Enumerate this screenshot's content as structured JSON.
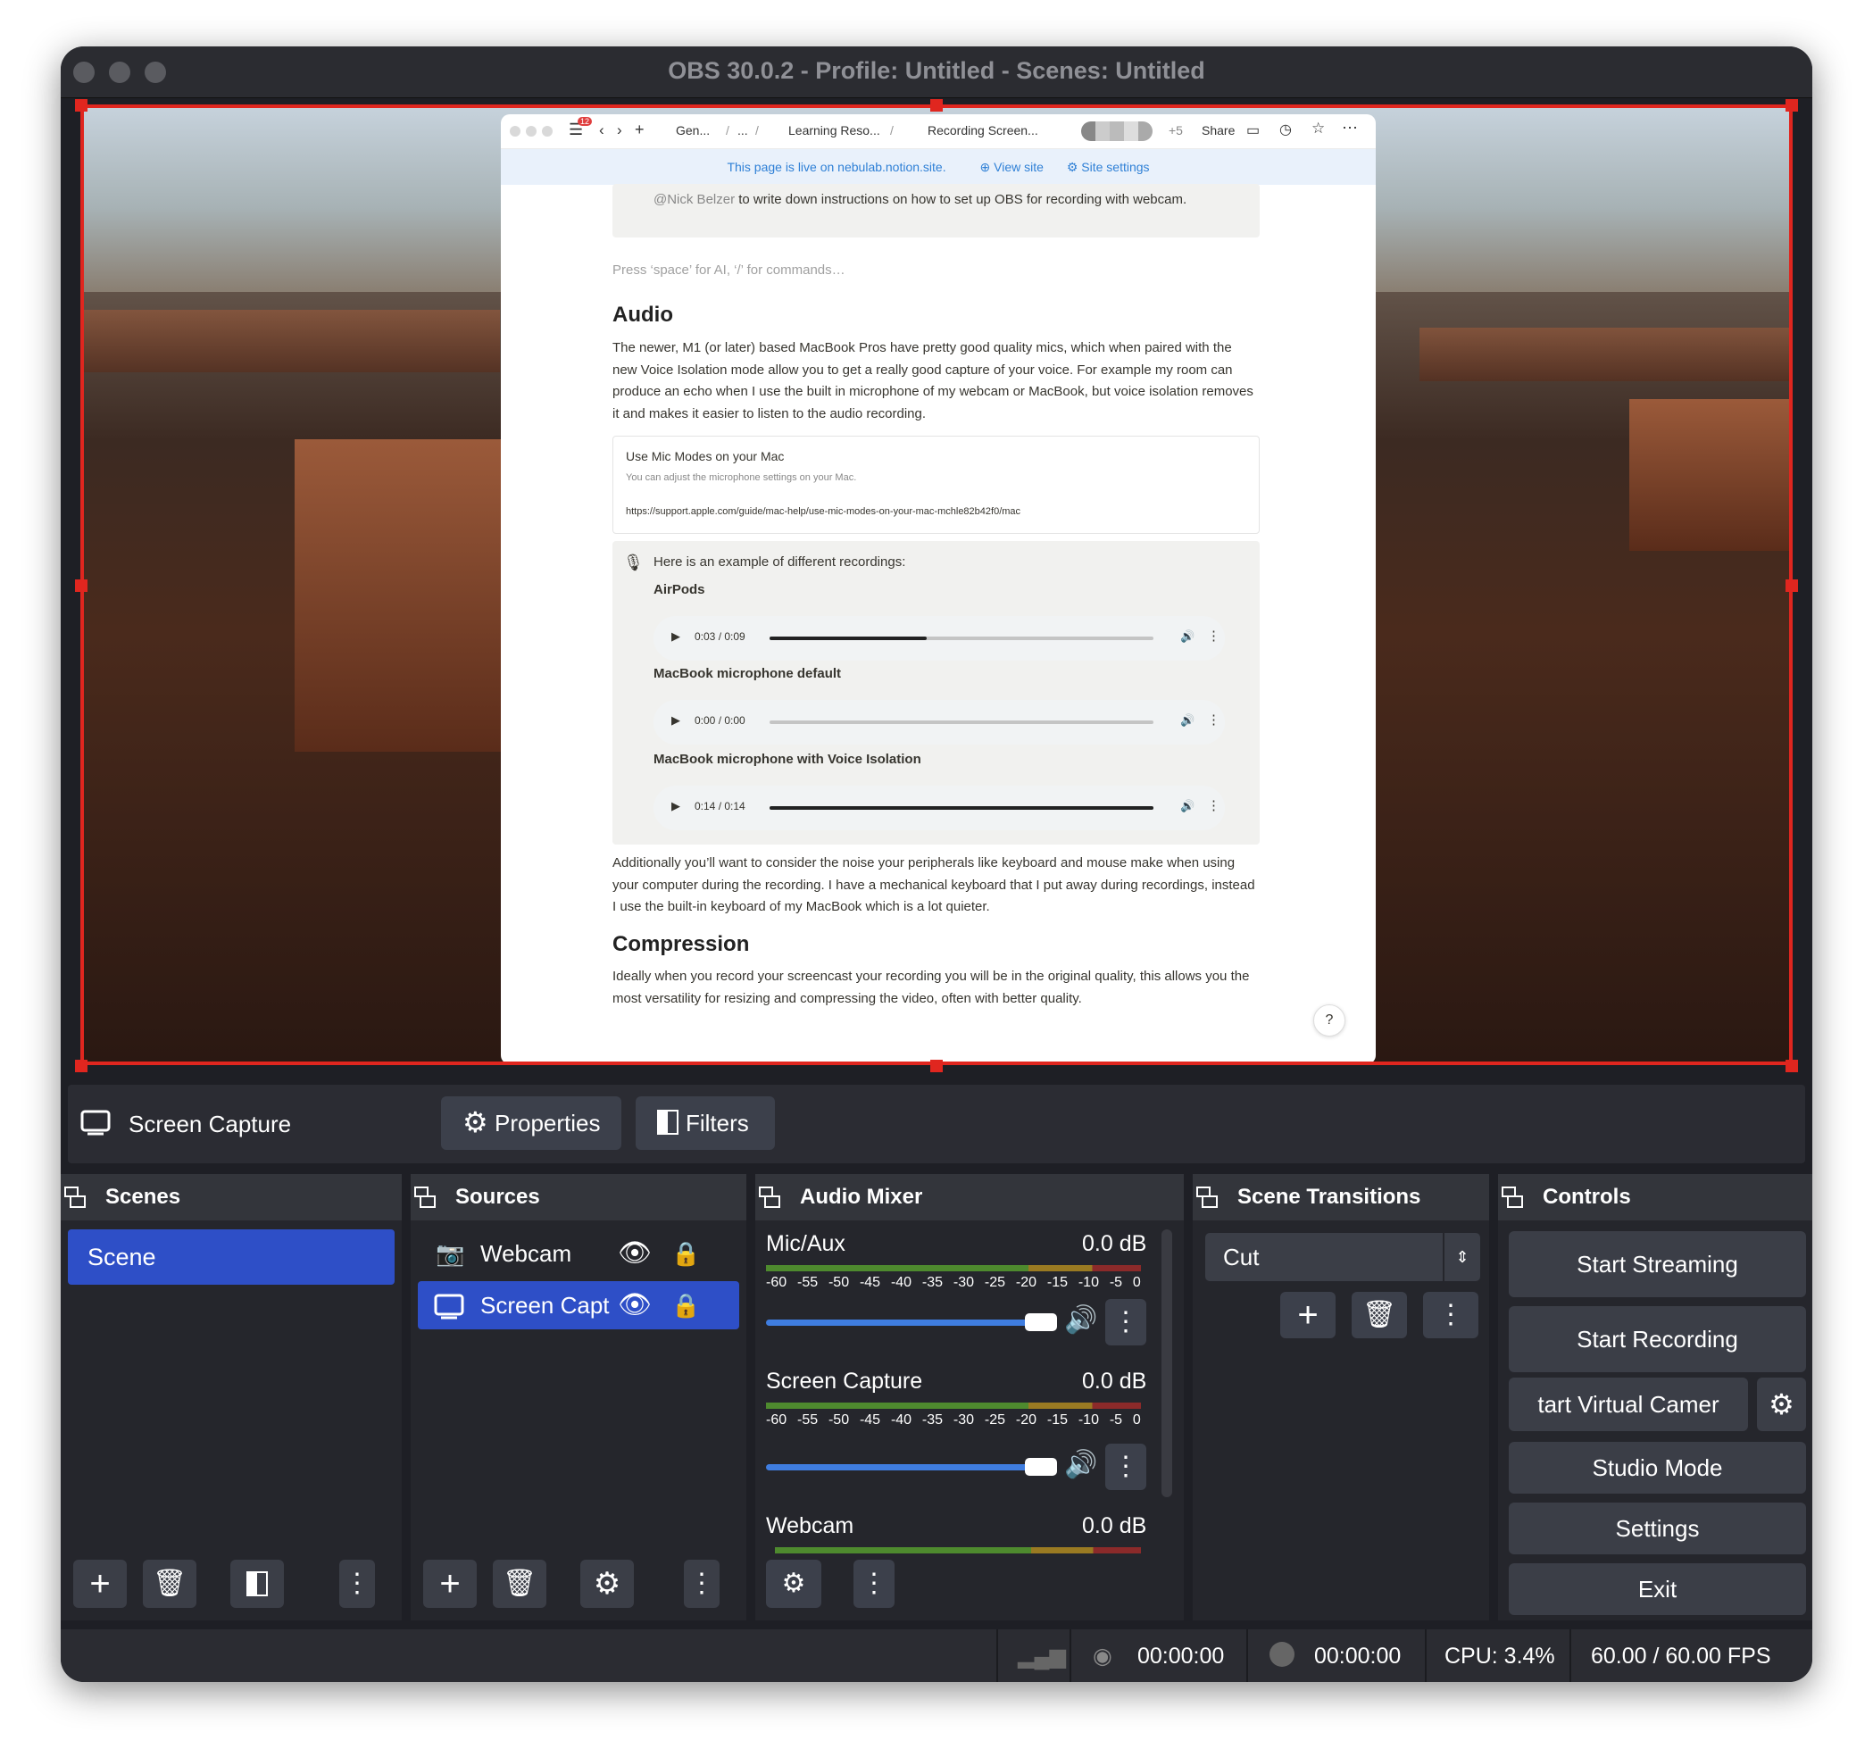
{
  "window": {
    "title": "OBS 30.0.2 - Profile: Untitled - Scenes: Untitled"
  },
  "browser": {
    "notification_count": "12",
    "breadcrumbs": [
      "Gen...",
      "/",
      "...",
      "/",
      "Learning Reso...",
      "/",
      "Recording Screen..."
    ],
    "collaborators_more": "+5",
    "share_label": "Share",
    "banner": {
      "text": "This page is live on nebulab.notion.site.",
      "view_site": "View site",
      "site_settings": "Site settings"
    },
    "callout_text_mention": "@Nick Belzer",
    "callout_text": " to write down instructions on how to set up OBS for recording with webcam.",
    "placeholder": "Press ‘space’ for AI, ‘/’ for commands…",
    "audio_heading": "Audio",
    "audio_paragraph": "The newer, M1 (or later) based MacBook Pros have pretty good quality mics, which when paired with the new Voice Isolation mode allow you to get a really good capture of your voice.  For example my room can produce an echo when I use the built in microphone of my webcam or MacBook, but voice isolation removes it and makes it easier to listen to the audio recording.",
    "bookmark": {
      "title": "Use Mic Modes on your Mac",
      "description": "You can adjust the microphone settings on your Mac.",
      "url": "https://support.apple.com/guide/mac-help/use-mic-modes-on-your-mac-mchle82b42f0/mac"
    },
    "recordings_intro": "Here is an example of different recordings:",
    "recordings": [
      {
        "label": "AirPods",
        "time": "0:03 / 0:09",
        "progress": 0.41
      },
      {
        "label": "MacBook microphone default",
        "time": "0:00 / 0:00",
        "progress": 0
      },
      {
        "label": "MacBook microphone with Voice Isolation",
        "time": "0:14 / 0:14",
        "progress": 1.0
      }
    ],
    "peripherals_paragraph": "Additionally you’ll want to consider the noise your peripherals like keyboard and mouse make when using your computer during the recording.  I have a mechanical keyboard that I put away during recordings, instead I use the built-in keyboard of my MacBook which is a lot quieter.",
    "compression_heading": "Compression",
    "compression_paragraph": "Ideally when you record your screencast your recording you will be in the original quality, this allows you the most versatility for resizing and compressing the video, often with better quality.",
    "help": "?"
  },
  "source_bar": {
    "source_name": "Screen Capture",
    "properties": "Properties",
    "filters": "Filters"
  },
  "scenes": {
    "title": "Scenes",
    "items": [
      "Scene"
    ]
  },
  "sources": {
    "title": "Sources",
    "items": [
      "Webcam",
      "Screen Capt"
    ]
  },
  "audio_mixer": {
    "title": "Audio Mixer",
    "ticks": [
      "-60",
      "-55",
      "-50",
      "-45",
      "-40",
      "-35",
      "-30",
      "-25",
      "-20",
      "-15",
      "-10",
      "-5",
      "0"
    ],
    "channels": [
      {
        "name": "Mic/Aux",
        "level": "0.0 dB",
        "volume": 1.0
      },
      {
        "name": "Screen Capture",
        "level": "0.0 dB",
        "volume": 1.0
      },
      {
        "name": "Webcam",
        "level": "0.0 dB"
      }
    ]
  },
  "transitions": {
    "title": "Scene Transitions",
    "selected": "Cut"
  },
  "controls": {
    "title": "Controls",
    "start_streaming": "Start Streaming",
    "start_recording": "Start Recording",
    "virtual_camera": "tart Virtual Camer",
    "studio_mode": "Studio Mode",
    "settings": "Settings",
    "exit": "Exit"
  },
  "status": {
    "stream_time": "00:00:00",
    "record_time": "00:00:00",
    "cpu": "CPU: 3.4%",
    "fps": "60.00 / 60.00 FPS"
  },
  "colors": {
    "accent": "#2e4fc7",
    "selection": "#e0261f",
    "panel": "#25262c",
    "button": "#3b3e47"
  }
}
